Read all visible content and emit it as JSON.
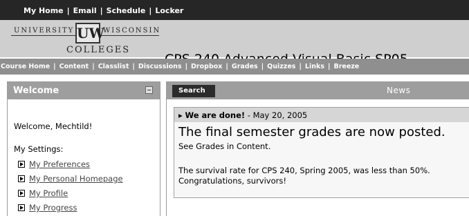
{
  "top_nav": {
    "items": [
      "My Home",
      "Email",
      "Schedule",
      "Locker"
    ],
    "separator": "|"
  },
  "header": {
    "logo": {
      "word1": "UNIVERSITY",
      "mark": "UW",
      "word2": "WISCONSIN",
      "word3": "COLLEGES"
    },
    "course_title": "CPS 240 Advanced Visual Basic SP05"
  },
  "course_nav": {
    "items": [
      "Course Home",
      "Content",
      "Classlist",
      "Discussions",
      "Dropbox",
      "Grades",
      "Quizzes",
      "Links",
      "Breeze"
    ],
    "separator": "|"
  },
  "welcome_panel": {
    "title": "Welcome",
    "greeting": "Welcome, Mechtild!",
    "settings_label": "My Settings:",
    "links": [
      "My Preferences",
      "My Personal Homepage",
      "My Profile",
      "My Progress"
    ]
  },
  "news_panel": {
    "search_label": "Search",
    "title": "News",
    "item": {
      "title": "We are done!",
      "date": " - May 20, 2005",
      "headline": "The final semester grades are now posted.",
      "line1": "See Grades in Content.",
      "line2": "The survival rate for CPS 240, Spring 2005, was less than 50%.",
      "line3": "Congratulations, survivors!"
    }
  },
  "icons": {
    "collapse": "minus-box-icon",
    "link_arrow": "arrow-box-icon",
    "news_expand": "triangle-right-icon"
  },
  "colors": {
    "top_bar": "#262626",
    "header_bg": "#cfcfcf",
    "nav_bar": "#8f8f8f",
    "panel_header": "#9e9e9e",
    "news_item_header": "#d6d6d6"
  }
}
